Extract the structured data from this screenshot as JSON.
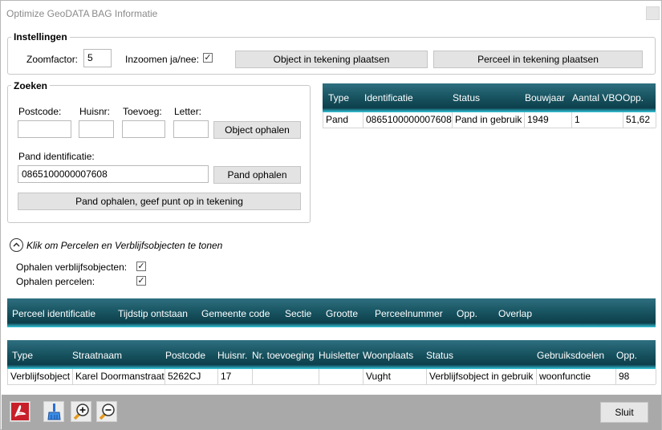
{
  "window": {
    "title": "Optimize GeoDATA   BAG Informatie"
  },
  "instellingen": {
    "legend": "Instellingen",
    "zoom_label": "Zoomfactor:",
    "zoom_value": "5",
    "zoom_check_label": "Inzoomen ja/nee:",
    "object_button": "Object in tekening plaatsen",
    "perceel_button": "Perceel in tekening plaatsen"
  },
  "zoeken": {
    "legend": "Zoeken",
    "postcode_label": "Postcode:",
    "huisnr_label": "Huisnr:",
    "toevoeg_label": "Toevoeg:",
    "letter_label": "Letter:",
    "object_ophalen_button": "Object ophalen",
    "pand_id_label": "Pand identificatie:",
    "pand_id_value": "0865100000007608",
    "pand_ophalen_button": "Pand ophalen",
    "pand_punt_button": "Pand ophalen, geef punt op in tekening"
  },
  "pand_grid": {
    "headers": [
      "Type",
      "Identificatie",
      "Status",
      "Bouwjaar",
      "Aantal VBO",
      "Opp."
    ],
    "rows": [
      [
        "Pand",
        "0865100000007608",
        "Pand in gebruik",
        "1949",
        "1",
        "51,62"
      ]
    ]
  },
  "expander": {
    "label": "Klik om Percelen en Verblijfsobjecten te tonen",
    "verblijf_label": "Ophalen verblijfsobjecten:",
    "percelen_label": "Ophalen percelen:"
  },
  "perceel_grid": {
    "headers": [
      "Perceel identificatie",
      "Tijdstip ontstaan",
      "Gemeente code",
      "Sectie",
      "Grootte",
      "Perceelnummer",
      "Opp.",
      "Overlap"
    ]
  },
  "vbo_grid": {
    "headers": [
      "Type",
      "Straatnaam",
      "Postcode",
      "Huisnr.",
      "Nr. toevoeging",
      "Huisletter",
      "Woonplaats",
      "Status",
      "Gebruiksdoelen",
      "Opp."
    ],
    "rows": [
      [
        "Verblijfsobject",
        "Karel Doormanstraat",
        "5262CJ",
        "17",
        "",
        "",
        "Vught",
        "Verblijfsobject in gebruik",
        "woonfunctie",
        "98"
      ]
    ]
  },
  "toolbar": {
    "icons": [
      "pdf-icon",
      "brush-icon",
      "zoom-in-icon",
      "zoom-out-icon"
    ],
    "sluit_button": "Sluit"
  },
  "colors": {
    "header_dark": "#17525f",
    "header_glow": "#36c8dc",
    "pdf_red": "#c8202a",
    "toolbar_bg": "#a9a9a9"
  }
}
